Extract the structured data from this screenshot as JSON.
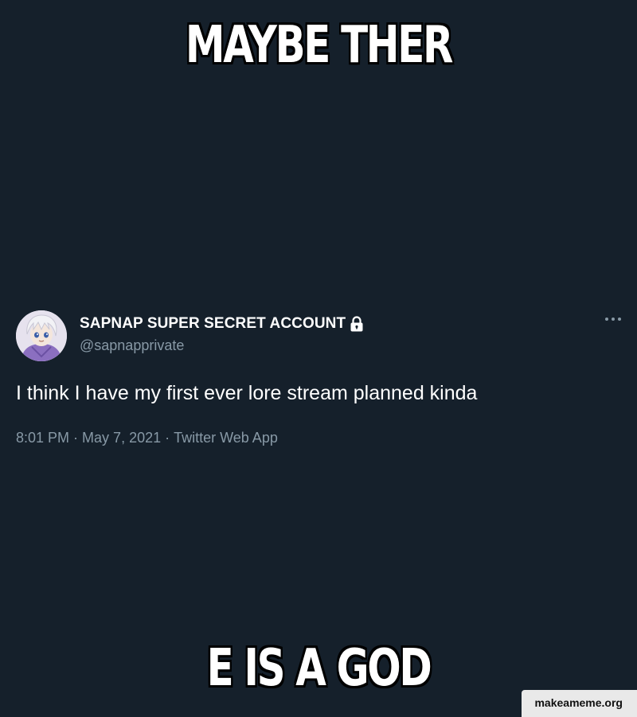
{
  "meme": {
    "top_text": "MAYBE THER",
    "bottom_text": "E IS A GOD"
  },
  "tweet": {
    "display_name": "SAPNAP SUPER SECRET ACCOUNT",
    "handle": "@sapnapprivate",
    "body": "I think I have my first ever lore stream planned kinda",
    "time": "8:01 PM",
    "date": "May 7, 2021",
    "client": "Twitter Web App",
    "separator": "·",
    "icons": {
      "avatar": "avatar-image",
      "lock": "lock-icon",
      "more": "more-options-icon"
    }
  },
  "watermark": "makeameme.org",
  "colors": {
    "background": "#15202b",
    "text_primary": "#ffffff",
    "text_secondary": "#8899a6"
  }
}
